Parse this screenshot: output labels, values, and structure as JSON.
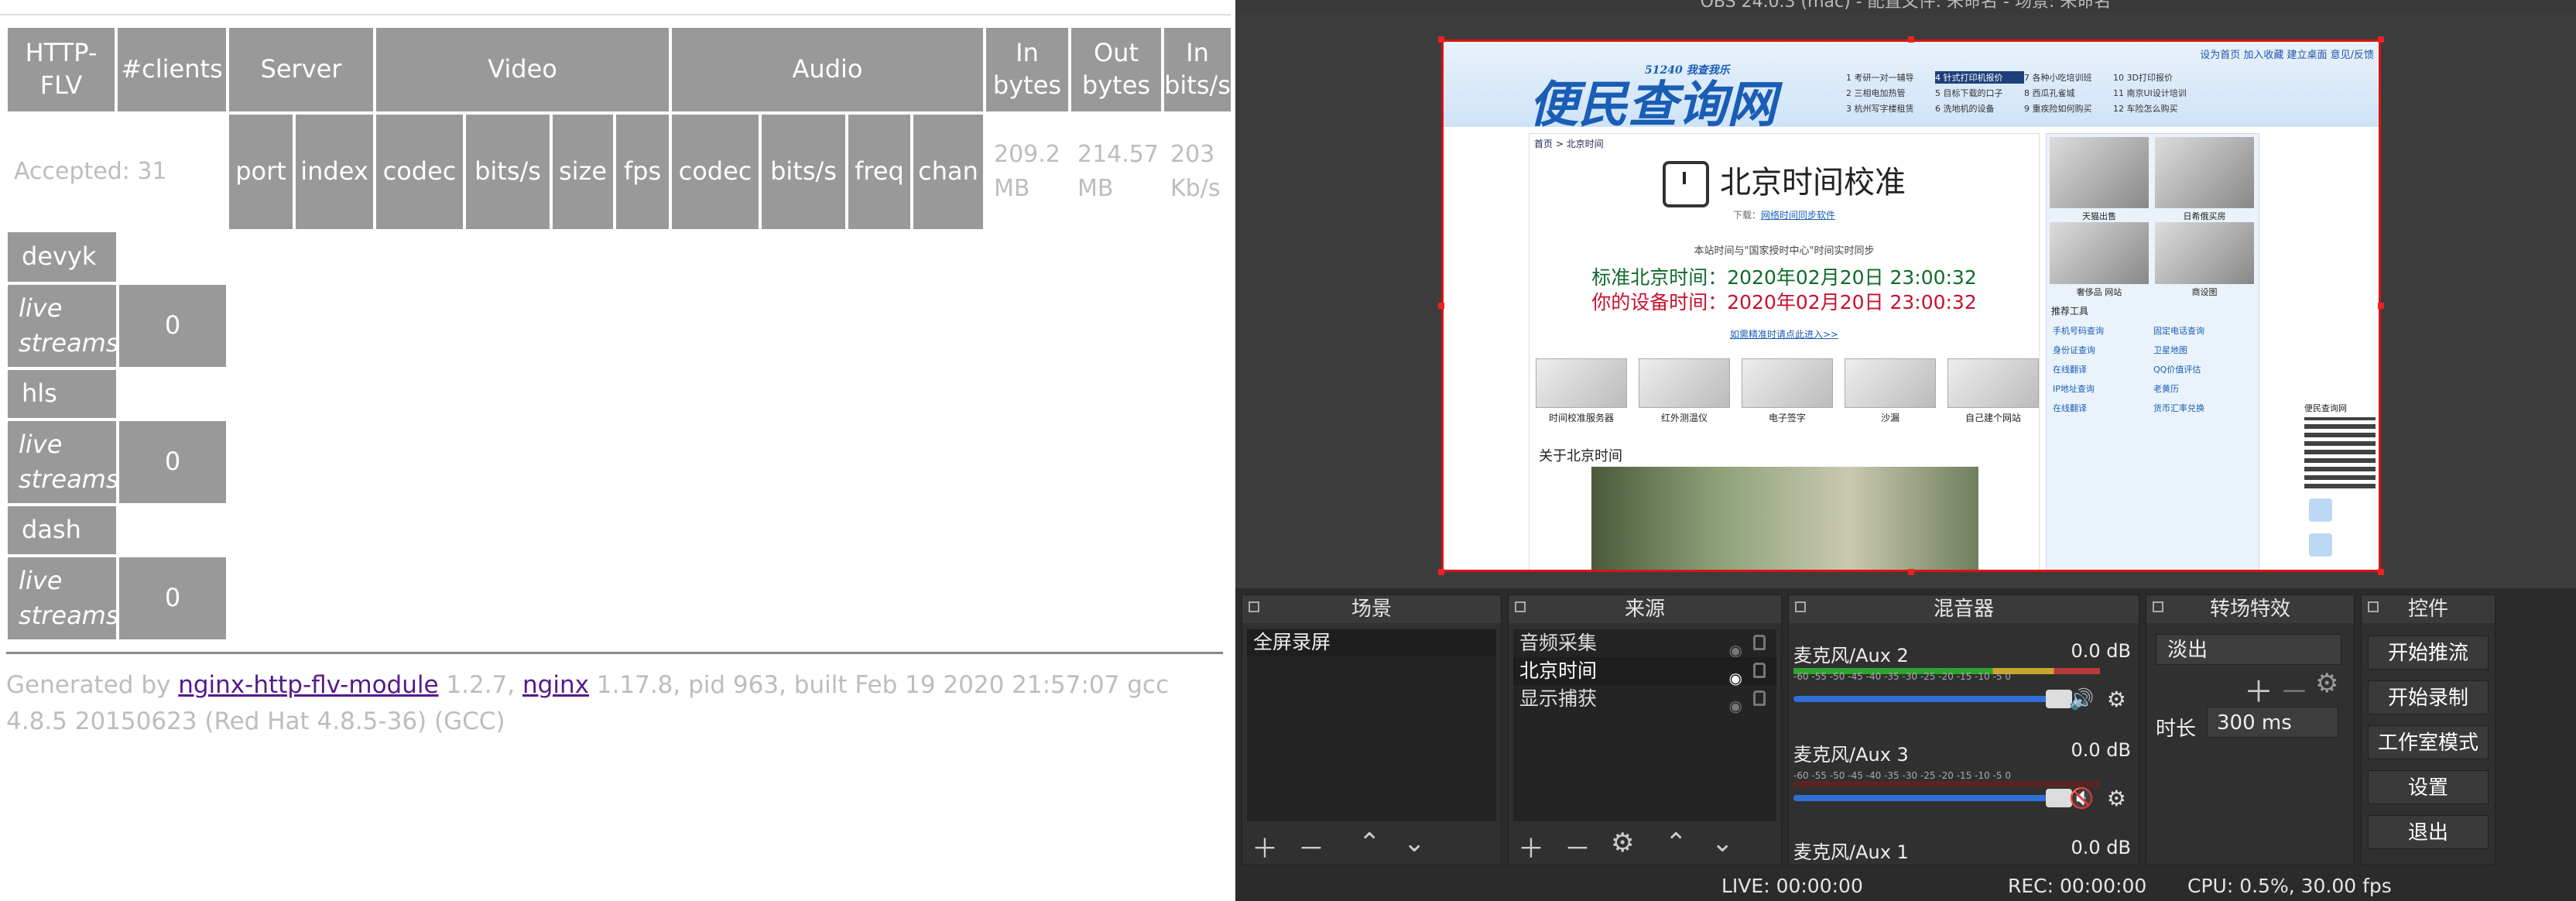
{
  "stats": {
    "headers": {
      "http_flv": "HTTP-FLV",
      "clients": "#clients",
      "server": "Server",
      "video": "Video",
      "audio": "Audio",
      "in_bytes": "In bytes",
      "out_bytes": "Out bytes",
      "in_bits": "In bits/s"
    },
    "accepted": "Accepted: 31",
    "subheaders": {
      "port": "port",
      "index": "index",
      "vcodec": "codec",
      "vbits": "bits/s",
      "size": "size",
      "fps": "fps",
      "acodec": "codec",
      "abits": "bits/s",
      "freq": "freq",
      "chan": "chan"
    },
    "in_bytes_val": "209.2 MB",
    "out_bytes_val": "214.57 MB",
    "in_bits_val": "203 Kb/s",
    "sections": [
      {
        "name": "devyk",
        "label": "live streams",
        "count": "0"
      },
      {
        "name": "hls",
        "label": "live streams",
        "count": "0"
      },
      {
        "name": "dash",
        "label": "live streams",
        "count": "0"
      }
    ],
    "footer": {
      "generated": "Generated by ",
      "module": "nginx-http-flv-module",
      "module_ver": " 1.2.7, ",
      "nginx": "nginx",
      "rest": " 1.17.8, pid 963, built Feb 19 2020 21:57:07 gcc 4.8.5 20150623 (Red Hat 4.8.5-36) (GCC)"
    }
  },
  "obs": {
    "title": "OBS 24.0.3 (mac) - 配置文件: 未命名 - 场景: 未命名",
    "webpage": {
      "toplinks": "设为首页  加入收藏  建立桌面  意见/反馈",
      "logo": "便民查询网",
      "logo_sub": "51240 我查我乐",
      "menu": [
        "1 考研一对一辅导",
        "4 针式打印机报价",
        "7 各种小吃培训班",
        "10 3D打印报价",
        "2 三相电加热管",
        "5 目标下载的口子",
        "8 西瓜孔雀城",
        "11 南京UI设计培训",
        "3 杭州写字楼租赁",
        "6 洗地机的设备",
        "9 重疾险如何购买",
        "12 车险怎么购买"
      ],
      "crumb": "首页 > 北京时间",
      "title": "北京时间校准",
      "download_label": "下载：",
      "download_link": "网络时间同步软件",
      "note": "本站时间与\"国家授时中心\"时间实时同步",
      "std_label": "标准北京时间：",
      "std_time": "2020年02月20日 23:00:32",
      "dev_label": "你的设备时间：",
      "dev_time": "2020年02月20日 23:00:32",
      "more_link": "如需精准时请点此进入>>",
      "thumbs": [
        "时间校准服务器",
        "红外测温仪",
        "电子签字",
        "沙漏",
        "自己建个网站"
      ],
      "about": "关于北京时间",
      "side_caps": [
        "天猫出售",
        "日希俄买房",
        "奢侈品 网站",
        "商设图"
      ],
      "tools_title": "推荐工具",
      "tools": [
        "手机号码查询",
        "固定电话查询",
        "身份证查询",
        "卫星地图",
        "在线翻译",
        "QQ价值评估",
        "IP地址查询",
        "老黄历",
        "在线翻译",
        "货币汇率兑换"
      ],
      "qr_label": "便民查询网"
    },
    "docks": {
      "scenes": {
        "title": "场景",
        "items": [
          "全屏录屏"
        ]
      },
      "sources": {
        "title": "来源",
        "items": [
          "音频采集",
          "北京时间",
          "显示捕获"
        ]
      },
      "mixer": {
        "title": "混音器",
        "channels": [
          {
            "name": "麦克风/Aux 2",
            "db": "0.0 dB"
          },
          {
            "name": "麦克风/Aux 3",
            "db": "0.0 dB"
          },
          {
            "name": "麦克风/Aux 1",
            "db": "0.0 dB"
          }
        ],
        "scale": "-60 -55 -50 -45 -40 -35 -30 -25 -20 -15 -10 -5 0"
      },
      "transitions": {
        "title": "转场特效",
        "selected": "淡出",
        "duration_label": "时长",
        "duration": "300 ms"
      },
      "controls": {
        "title": "控件",
        "buttons": [
          "开始推流",
          "开始录制",
          "工作室模式",
          "设置",
          "退出"
        ]
      }
    },
    "status": {
      "live": "LIVE: 00:00:00",
      "rec": "REC: 00:00:00",
      "cpu": "CPU: 0.5%, 30.00 fps"
    }
  }
}
